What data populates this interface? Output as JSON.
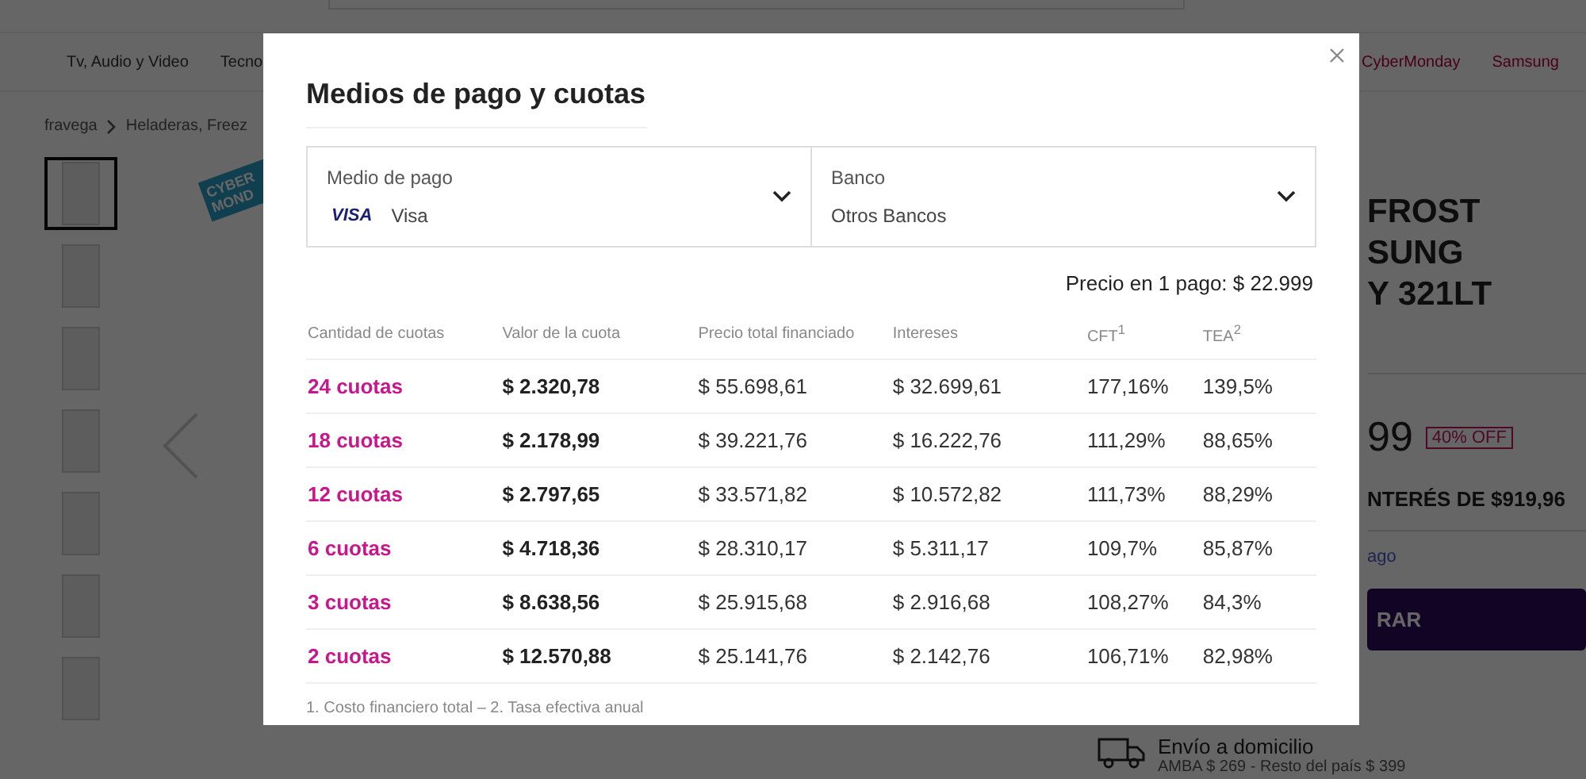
{
  "page": {
    "nav": [
      {
        "label": "Tv, Audio y Video",
        "kind": "regular"
      },
      {
        "label": "Tecno",
        "kind": "regular"
      },
      {
        "label": "CyberMonday",
        "kind": "promo"
      },
      {
        "label": "Samsung",
        "kind": "promo"
      }
    ],
    "breadcrumb": [
      "fravega",
      "Heladeras, Freez"
    ],
    "thumbnails": [
      {
        "selected": true
      },
      {
        "selected": false
      },
      {
        "selected": false
      },
      {
        "selected": false
      },
      {
        "selected": false
      },
      {
        "selected": false
      },
      {
        "selected": false
      }
    ],
    "badge": "CYBER MOND",
    "title_lines": [
      "FROST",
      "SUNG",
      "Y 321LT"
    ],
    "price": "99",
    "discount": "40% OFF",
    "installments": "NTERÉS DE $919,96",
    "payment_link": "ago",
    "buy_button": "RAR",
    "delivery": {
      "title": "Envío a domicilio",
      "detail": "AMBA $ 269 - Resto del país $ 399"
    }
  },
  "modal": {
    "title": "Medios de pago y cuotas",
    "selects": [
      {
        "label": "Medio de pago",
        "logo": "VISA",
        "value": "Visa"
      },
      {
        "label": "Banco",
        "value": "Otros Bancos"
      }
    ],
    "single_payment": "Precio en 1 pago: $ 22.999",
    "table": {
      "columns": [
        "Cantidad de cuotas",
        "Valor de la cuota",
        "Precio total financiado",
        "Intereses",
        "CFT$^{1}$",
        "TEA$^{2}$"
      ],
      "rows": [
        [
          "24 cuotas",
          "$ 2.320,78",
          "$ 55.698,61",
          "$ 32.699,61",
          "177,16%",
          "139,5%"
        ],
        [
          "18 cuotas",
          "$ 2.178,99",
          "$ 39.221,76",
          "$ 16.222,76",
          "111,29%",
          "88,65%"
        ],
        [
          "12 cuotas",
          "$ 2.797,65",
          "$ 33.571,82",
          "$ 10.572,82",
          "111,73%",
          "88,29%"
        ],
        [
          "6 cuotas",
          "$ 4.718,36",
          "$ 28.310,17",
          "$ 5.311,17",
          "109,7%",
          "85,87%"
        ],
        [
          "3 cuotas",
          "$ 8.638,56",
          "$ 25.915,68",
          "$ 2.916,68",
          "108,27%",
          "84,3%"
        ],
        [
          "2 cuotas",
          "$ 12.570,88",
          "$ 25.141,76",
          "$ 2.142,76",
          "106,71%",
          "82,98%"
        ]
      ]
    },
    "footnote": "1. Costo financiero total – 2. Tasa efectiva anual"
  }
}
